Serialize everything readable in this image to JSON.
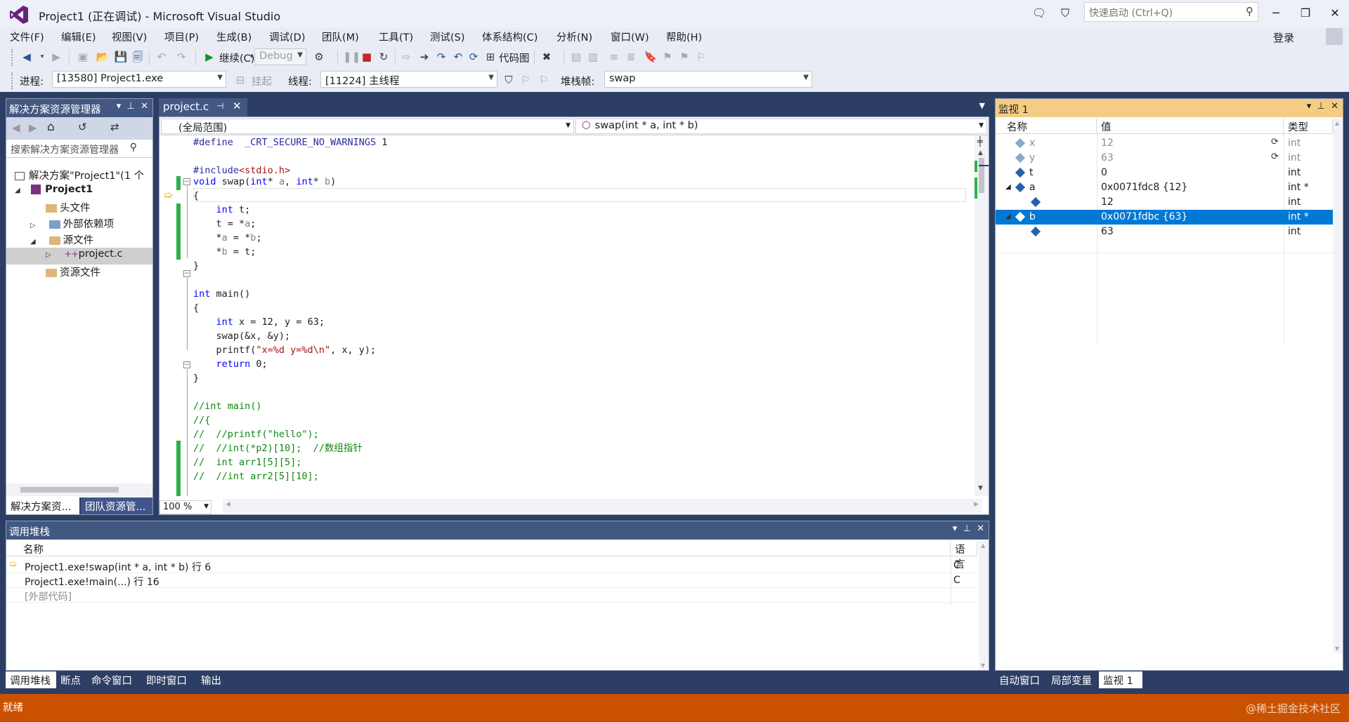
{
  "window": {
    "title": "Project1 (正在调试) - Microsoft Visual Studio",
    "quick_launch_placeholder": "快速启动 (Ctrl+Q)",
    "login": "登录"
  },
  "menu": [
    "文件(F)",
    "编辑(E)",
    "视图(V)",
    "项目(P)",
    "生成(B)",
    "调试(D)",
    "团队(M)",
    "工具(T)",
    "测试(S)",
    "体系结构(C)",
    "分析(N)",
    "窗口(W)",
    "帮助(H)"
  ],
  "toolbar": {
    "continue_label": "继续(C)",
    "config_value": "Debug",
    "code_map_label": "代码图",
    "process_label": "进程:",
    "process_value": "[13580] Project1.exe",
    "suspend_label": "挂起",
    "thread_label": "线程:",
    "thread_value": "[11224] 主线程",
    "stackframe_label": "堆栈帧:",
    "stackframe_value": "swap"
  },
  "solution_explorer": {
    "title": "解决方案资源管理器",
    "search_placeholder": "搜索解决方案资源管理器",
    "items": [
      {
        "label": "解决方案\"Project1\"(1 个",
        "indent": 0
      },
      {
        "label": "Project1",
        "indent": 1
      },
      {
        "label": "头文件",
        "indent": 2
      },
      {
        "label": "外部依赖项",
        "indent": 2
      },
      {
        "label": "源文件",
        "indent": 2
      },
      {
        "label": "project.c",
        "indent": 3
      },
      {
        "label": "资源文件",
        "indent": 2
      }
    ],
    "tabs": [
      "解决方案资...",
      "团队资源管..."
    ]
  },
  "editor": {
    "tab_label": "project.c",
    "scope_value": "(全局范围)",
    "function_value": "swap(int * a, int * b)",
    "zoom": "100 %"
  },
  "code_lines": [
    "#define  _CRT_SECURE_NO_WARNINGS 1",
    "",
    "#include<stdio.h>",
    "",
    "void swap(int* a, int* b)",
    "{",
    "    int t;",
    "    t = *a;",
    "    *a = *b;",
    "    *b = t;",
    "}",
    "",
    "int main()",
    "{",
    "    int x = 12, y = 63;",
    "    swap(&x, &y);",
    "    printf(\"x=%d y=%d\\n\", x, y);",
    "    return 0;",
    "}",
    "",
    "//int main()",
    "//{",
    "//  //printf(\"hello\");",
    "//  //int(*p2)[10];  //数组指针",
    "//  int arr1[5][5];",
    "//  //int arr2[5][10];"
  ],
  "watch": {
    "title": "监视 1",
    "headers": [
      "名称",
      "值",
      "类型"
    ],
    "rows": [
      {
        "name": "x",
        "value": "12",
        "type": "int",
        "stale": true
      },
      {
        "name": "y",
        "value": "63",
        "type": "int",
        "stale": true
      },
      {
        "name": "t",
        "value": "0",
        "type": "int",
        "stale": false
      },
      {
        "name": "a",
        "value": "0x0071fdc8 {12}",
        "type": "int *",
        "stale": false
      },
      {
        "name": "",
        "value": "12",
        "type": "int",
        "stale": false
      },
      {
        "name": "b",
        "value": "0x0071fdbc {63}",
        "type": "int *",
        "stale": false
      },
      {
        "name": "",
        "value": "63",
        "type": "int",
        "stale": false
      }
    ],
    "tabs": [
      "自动窗口",
      "局部变量",
      "监视 1"
    ]
  },
  "callstack": {
    "title": "调用堆栈",
    "headers": [
      "名称",
      "语言"
    ],
    "rows": [
      {
        "name": "Project1.exe!swap(int * a, int * b) 行 6",
        "lang": "C"
      },
      {
        "name": "Project1.exe!main(...) 行 16",
        "lang": "C"
      },
      {
        "name": "[外部代码]",
        "lang": ""
      }
    ],
    "tabs": [
      "调用堆栈",
      "断点",
      "命令窗口",
      "即时窗口",
      "输出"
    ]
  },
  "status": {
    "text": "就绪",
    "watermark": "@稀土掘金技术社区"
  }
}
